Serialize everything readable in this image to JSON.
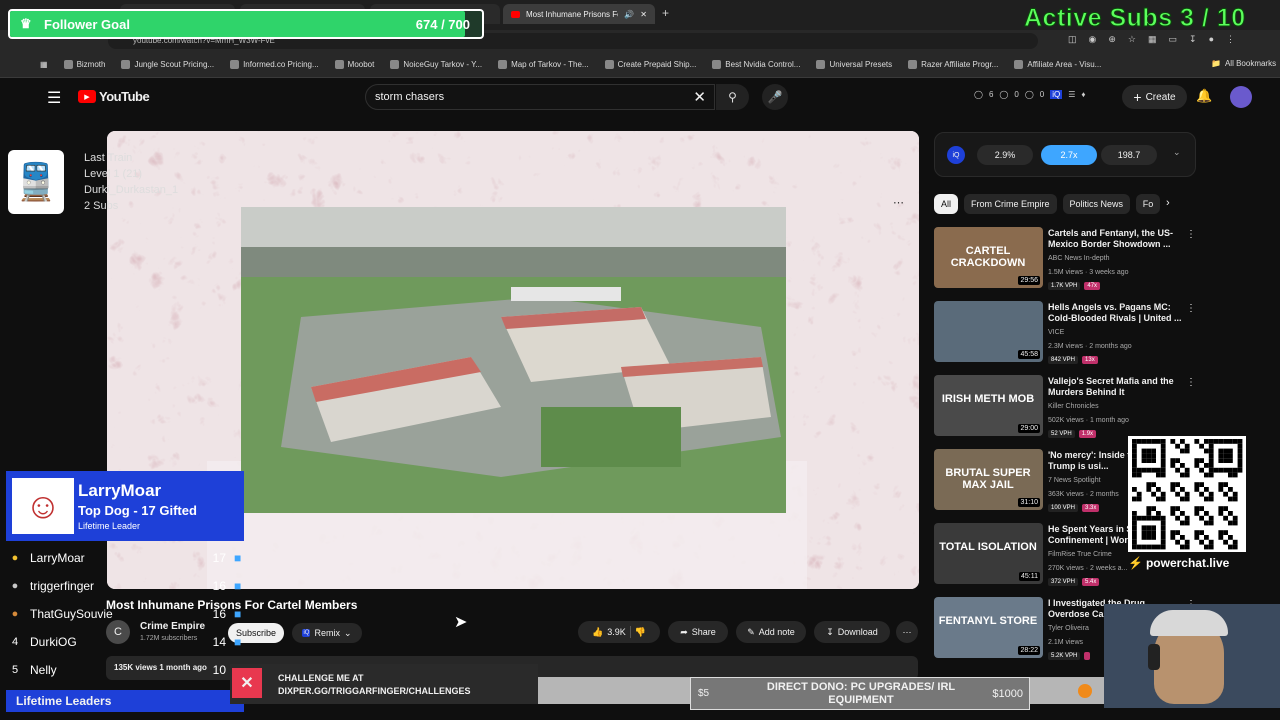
{
  "overlay": {
    "follower_goal_label": "Follower Goal",
    "follower_goal_count": "674 / 700",
    "follower_progress": 0.963,
    "active_subs": "Active Subs  3 / 10",
    "last_train_lines": [
      "Last Train",
      "Level 1 (21)",
      "Durki_Durkastan_1",
      "2 Subs"
    ],
    "leader_name": "LarryMoar",
    "leader_sub": "Top Dog - 17 Gifted",
    "leader_caption": "Lifetime Leader",
    "footer_label": "Lifetime Leaders",
    "leaders": [
      {
        "rank": "1",
        "name": "LarryMoar",
        "count": "17"
      },
      {
        "rank": "2",
        "name": "triggerfinger",
        "count": "16"
      },
      {
        "rank": "3",
        "name": "ThatGuySouvie",
        "count": "16"
      },
      {
        "rank": "4",
        "name": "DurkiOG",
        "count": "14"
      },
      {
        "rank": "5",
        "name": "Nelly",
        "count": "10"
      }
    ],
    "challenge_line1": "CHALLENGE ME AT",
    "challenge_line2": "DIXPER.GG/TRIGGARFINGER/CHALLENGES",
    "dono_text": "DIRECT DONO: PC UPGRADES/ IRL EQUIPMENT",
    "dono_min": "$5",
    "dono_max": "$1000",
    "powerchat": "powerchat.live"
  },
  "browser": {
    "tab_title": "Most Inhumane Prisons Fo",
    "url": "youtube.com/watch?v=MmH_W3W-FvE",
    "bookmarks": [
      "Bizmoth",
      "Jungle Scout Pricing...",
      "Informed.co Pricing...",
      "Moobot",
      "NoiceGuy Tarkov - Y...",
      "Map of Tarkov - The...",
      "Create Prepaid Ship...",
      "Best Nvidia Control...",
      "Universal Presets",
      "Razer Affiliate Progr...",
      "Affiliate Area - Visu..."
    ],
    "all_bookmarks": "All Bookmarks"
  },
  "youtube": {
    "logo": "YouTube",
    "search_value": "storm chasers",
    "create_label": "Create",
    "ext_counts": [
      "6",
      "0",
      "0"
    ],
    "stats": [
      "2.9%",
      "2.7x",
      "198.7"
    ],
    "chips": [
      "All",
      "From Crime Empire",
      "Politics News",
      "Fo"
    ],
    "video_title": "Most Inhumane Prisons For Cartel Members",
    "channel": "Crime Empire",
    "subscribers": "1.72M subscribers",
    "subscribe": "Subscribe",
    "remix": "Remix",
    "likes": "3.9K",
    "share": "Share",
    "add_note": "Add note",
    "download": "Download",
    "views": "135K views  1 month ago",
    "recs": [
      {
        "title": "Cartels and Fentanyl, the US-Mexico Border Showdown ...",
        "channel": "ABC News In-depth",
        "meta": "1.5M views · 3 weeks ago",
        "vph": "1.7K VPH",
        "mult": "47x",
        "dur": "29:56",
        "thumb": "CARTEL CRACKDOWN",
        "color": "#8a6b4e"
      },
      {
        "title": "Hells Angels vs. Pagans MC: Cold-Blooded Rivals | United ...",
        "channel": "VICE",
        "meta": "2.3M views · 2 months ago",
        "vph": "842 VPH",
        "mult": "13x",
        "dur": "45:58",
        "thumb": "",
        "color": "#5a6b7a"
      },
      {
        "title": "Vallejo's Secret Mafia and the Murders Behind It",
        "channel": "Killer Chronicles",
        "meta": "502K views · 1 month ago",
        "vph": "52 VPH",
        "mult": "1.9x",
        "dur": "29:00",
        "thumb": "IRISH METH MOB",
        "color": "#4a4a4a"
      },
      {
        "title": "'No mercy': Inside the prison Trump is usi...",
        "channel": "7 News Spotlight",
        "meta": "363K views · 2 months",
        "vph": "100 VPH",
        "mult": "3.3x",
        "dur": "31:10",
        "thumb": "BRUTAL SUPER MAX JAIL",
        "color": "#7a6a55"
      },
      {
        "title": "He Spent Years in S... Confinement | Work...",
        "channel": "FilmRise True Crime",
        "meta": "270K views · 2 weeks a...",
        "vph": "372 VPH",
        "mult": "5.4x",
        "dur": "45:11",
        "thumb": "TOTAL ISOLATION",
        "color": "#3a3a3a"
      },
      {
        "title": "I Investigated the Drug... Overdose Cap...",
        "channel": "Tyler Oliveira",
        "meta": "2.1M views",
        "vph": "5.2K VPH",
        "mult": "",
        "dur": "28:22",
        "thumb": "FENTANYL STORE",
        "color": "#6a7a8a"
      }
    ]
  },
  "colors": {
    "goal_green": "#2fd46a",
    "accent_blue": "#3ea6ff",
    "sub_blue": "#1e40d8",
    "active_subs_green": "#5cff5c"
  }
}
